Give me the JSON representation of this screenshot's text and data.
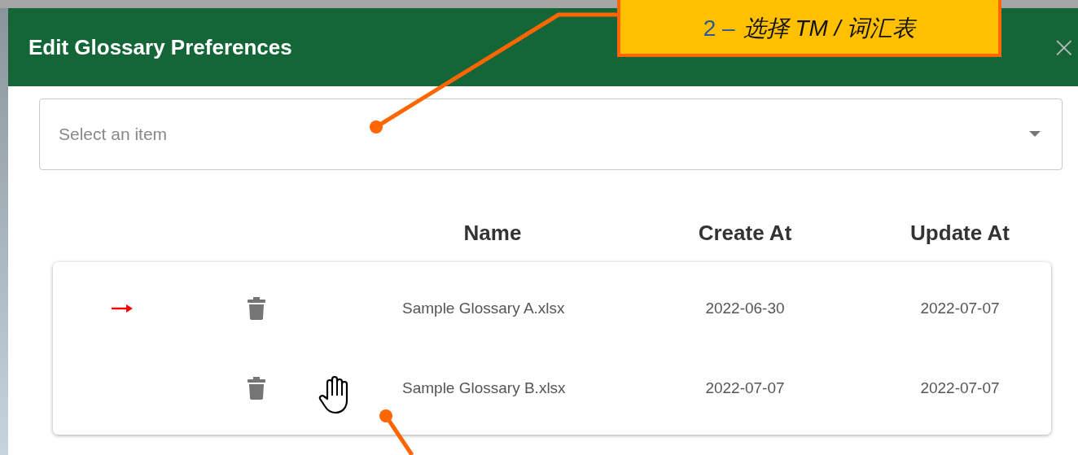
{
  "dialog": {
    "title": "Edit Glossary Preferences",
    "close": "×"
  },
  "select": {
    "placeholder": "Select an item"
  },
  "table": {
    "columns": [
      "Name",
      "Create At",
      "Update At"
    ],
    "rows": [
      {
        "current": true,
        "name": "Sample Glossary A.xlsx",
        "created": "2022-06-30",
        "updated": "2022-07-07"
      },
      {
        "current": false,
        "name": "Sample Glossary B.xlsx",
        "created": "2022-07-07",
        "updated": "2022-07-07"
      }
    ]
  },
  "callout": {
    "number": "2 –",
    "text": "选择 TM / 词汇表"
  }
}
